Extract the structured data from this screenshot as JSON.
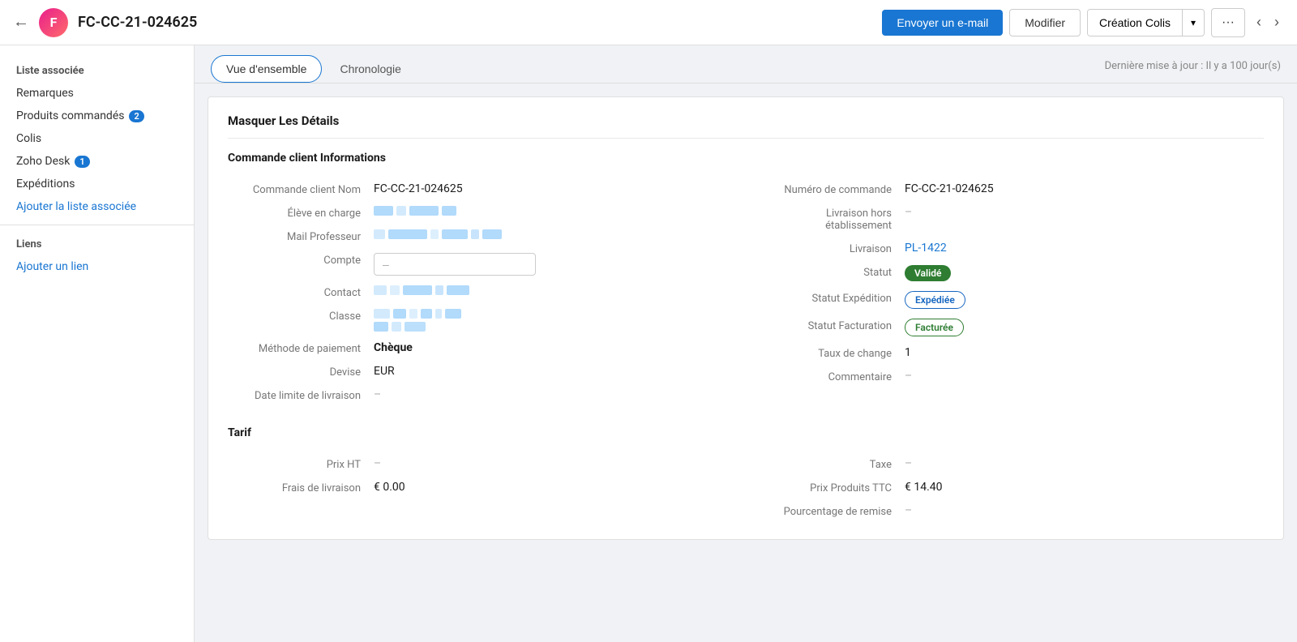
{
  "header": {
    "back_icon": "←",
    "avatar_letter": "F",
    "record_id": "FC-CC-21-024625",
    "buttons": {
      "email": "Envoyer un e-mail",
      "modifier": "Modifier",
      "creation_colis": "Création Colis",
      "more_icon": "···",
      "nav_prev": "‹",
      "nav_next": "›"
    }
  },
  "sidebar": {
    "liste_associee_title": "Liste associée",
    "items": [
      {
        "label": "Remarques",
        "badge": null
      },
      {
        "label": "Produits commandés",
        "badge": "2"
      },
      {
        "label": "Colis",
        "badge": null
      },
      {
        "label": "Zoho Desk",
        "badge": "1"
      },
      {
        "label": "Expéditions",
        "badge": null
      }
    ],
    "ajouter_liste": "Ajouter la liste associée",
    "liens_title": "Liens",
    "ajouter_lien": "Ajouter un lien"
  },
  "tabs": {
    "vue_ensemble": "Vue d'ensemble",
    "chronologie": "Chronologie",
    "last_updated": "Dernière mise à jour : Il y a 100 jour(s)"
  },
  "card": {
    "hide_label": "Masquer Les Détails",
    "section_title": "Commande client Informations",
    "left_fields": [
      {
        "label": "Commande client Nom",
        "value": "FC-CC-21-024625",
        "type": "text"
      },
      {
        "label": "Élève en charge",
        "value": null,
        "type": "blurred"
      },
      {
        "label": "Mail Professeur",
        "value": null,
        "type": "blurred"
      },
      {
        "label": "Compte",
        "value": "–",
        "type": "input"
      },
      {
        "label": "Contact",
        "value": null,
        "type": "blurred"
      },
      {
        "label": "Classe",
        "value": null,
        "type": "blurred2"
      },
      {
        "label": "Méthode de paiement",
        "value": "Chèque",
        "type": "bold"
      },
      {
        "label": "Devise",
        "value": "EUR",
        "type": "text"
      },
      {
        "label": "Date limite de livraison",
        "value": "–",
        "type": "empty"
      }
    ],
    "right_fields": [
      {
        "label": "Numéro de commande",
        "value": "FC-CC-21-024625",
        "type": "text"
      },
      {
        "label": "Livraison hors établissement",
        "value": "–",
        "type": "empty"
      },
      {
        "label": "Livraison",
        "value": "PL-1422",
        "type": "link"
      },
      {
        "label": "Statut",
        "value": "Validé",
        "type": "badge_green"
      },
      {
        "label": "Statut Expédition",
        "value": "Expédiée",
        "type": "badge_outline_blue"
      },
      {
        "label": "Statut Facturation",
        "value": "Facturée",
        "type": "badge_outline_green"
      },
      {
        "label": "Taux de change",
        "value": "1",
        "type": "text"
      },
      {
        "label": "Commentaire",
        "value": "–",
        "type": "empty"
      }
    ],
    "tarif_title": "Tarif",
    "tarif_left": [
      {
        "label": "Prix HT",
        "value": "–",
        "type": "empty"
      },
      {
        "label": "Frais de livraison",
        "value": "€ 0.00",
        "type": "text"
      }
    ],
    "tarif_right": [
      {
        "label": "Taxe",
        "value": "–",
        "type": "empty"
      },
      {
        "label": "Prix Produits TTC",
        "value": "€ 14.40",
        "type": "text"
      },
      {
        "label": "Pourcentage de remise",
        "value": "–",
        "type": "empty"
      }
    ]
  }
}
